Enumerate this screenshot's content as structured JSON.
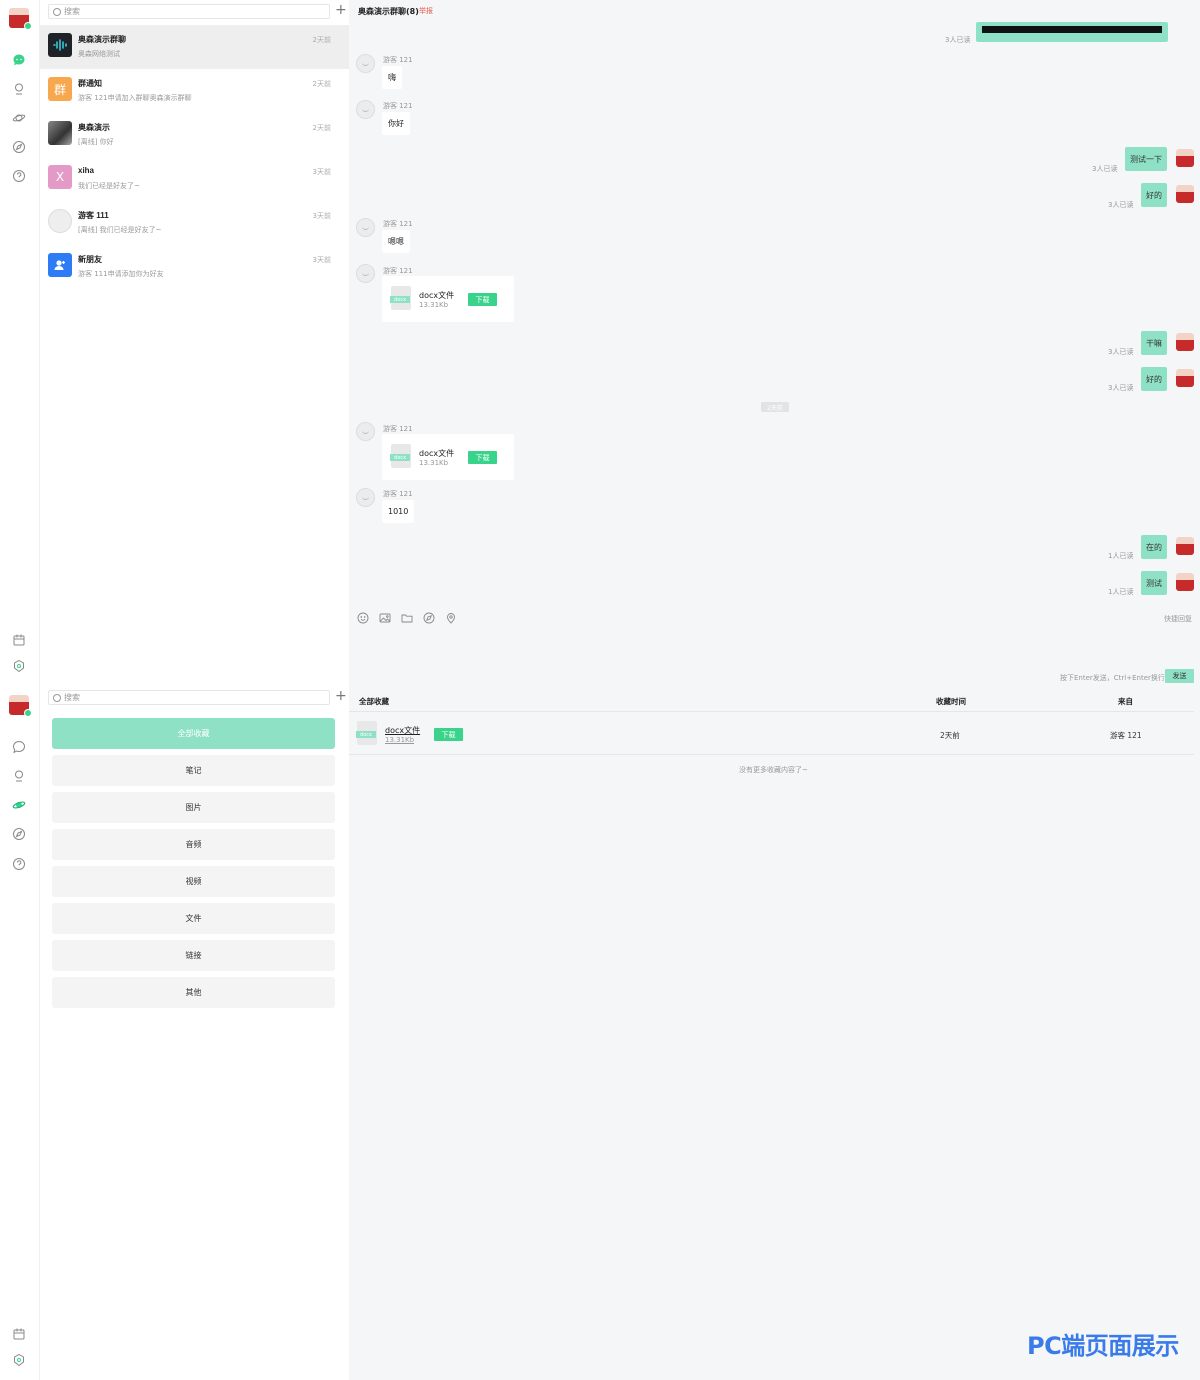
{
  "conversation_search": {
    "placeholder": "搜索"
  },
  "favorites_search": {
    "placeholder": "搜索"
  },
  "conversations": [
    {
      "name": "奥森演示群聊",
      "preview": "奥森网络测试",
      "time": "2天前",
      "icon": "sound-wave-icon",
      "color": "#1f2328"
    },
    {
      "name": "群通知",
      "preview": "游客 121申请加入群聊奥森演示群聊",
      "time": "2天前",
      "avatar_text": "群",
      "color": "#f7a84e"
    },
    {
      "name": "奥森演示",
      "preview": "[离线] 你好",
      "time": "2天前",
      "icon": "photo-avatar-icon",
      "color": "#555555"
    },
    {
      "name": "xiha",
      "preview": "我们已经是好友了~",
      "time": "3天前",
      "avatar_text": "X",
      "color": "#e39ac6"
    },
    {
      "name": "游客 111",
      "preview": "[离线] 我们已经是好友了~",
      "time": "3天前",
      "icon": "guest-avatar-icon",
      "color": "#eeeeee"
    },
    {
      "name": "新朋友",
      "preview": "游客 111申请添加你为好友",
      "time": "3天前",
      "icon": "add-user-icon",
      "color": "#2d7cf6"
    }
  ],
  "favorite_categories": [
    "全部收藏",
    "笔记",
    "图片",
    "音频",
    "视频",
    "文件",
    "链接",
    "其他"
  ],
  "chat": {
    "title": "奥森演示群聊(8)",
    "report": "举报",
    "top_read": "3人已读",
    "messages": [
      {
        "sender": "游客 121",
        "text": "嗨"
      },
      {
        "sender": "游客 121",
        "text": "你好"
      },
      {
        "text": "测试一下",
        "read": "3人已读"
      },
      {
        "text": "好的",
        "read": "3人已读"
      },
      {
        "sender": "游客 121",
        "text": "嗯嗯"
      },
      {
        "sender": "游客 121",
        "file": "docx文件",
        "size": "13.31Kb",
        "badge": "docx",
        "download": "下载"
      },
      {
        "text": "干嘛",
        "read": "3人已读"
      },
      {
        "text": "好的",
        "read": "3人已读"
      },
      {
        "sender": "游客 121",
        "file": "docx文件",
        "size": "13.31Kb",
        "badge": "docx",
        "download": "下载"
      },
      {
        "sender": "游客 121",
        "text": "1010"
      },
      {
        "text": "在的",
        "read": "1人已读"
      },
      {
        "text": "测试",
        "read": "1人已读"
      }
    ],
    "day_divider": "2天前",
    "quick_reply": "快捷回复",
    "send_hint": "按下Enter发送，Ctrl+Enter换行",
    "send": "发送"
  },
  "favorites": {
    "columns": [
      "全部收藏",
      "收藏时间",
      "来自"
    ],
    "rows": [
      {
        "name": "docx文件",
        "size": "13.31Kb",
        "badge": "docx",
        "download": "下载",
        "time": "2天前",
        "from": "游客 121"
      }
    ],
    "empty": "没有更多收藏内容了~"
  },
  "watermark": "PC端页面展示",
  "colors": {
    "accent": "#8fe1c6",
    "green": "#3ad38b",
    "report": "#e65a4e",
    "watermark": "#3a7bea"
  }
}
